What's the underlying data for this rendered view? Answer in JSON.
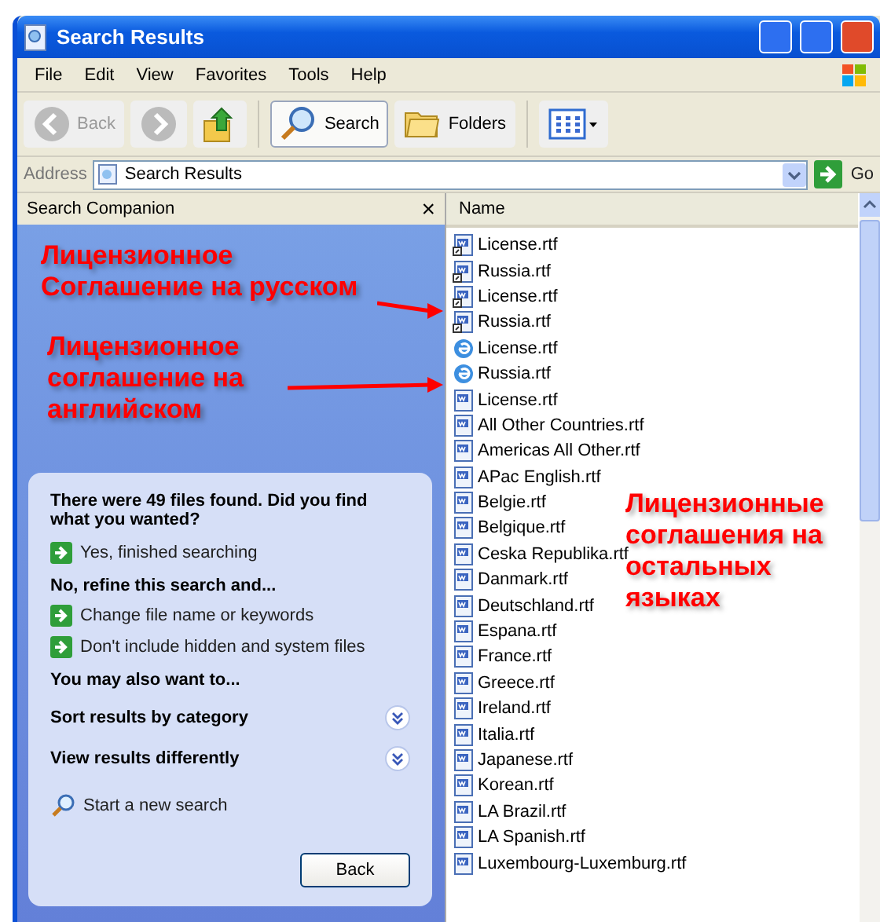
{
  "window": {
    "title": "Search Results"
  },
  "menu": [
    "File",
    "Edit",
    "View",
    "Favorites",
    "Tools",
    "Help"
  ],
  "toolbar": [
    {
      "kind": "back",
      "label": "Back",
      "disabled": true
    },
    {
      "kind": "forward",
      "disabled": true
    },
    {
      "kind": "up"
    },
    {
      "kind": "search",
      "label": "Search",
      "selected": true
    },
    {
      "kind": "folders",
      "label": "Folders",
      "selected": false
    },
    {
      "kind": "views"
    }
  ],
  "address": {
    "label": "Address",
    "value": "Search Results",
    "go": "Go"
  },
  "companion": {
    "title": "Search Companion",
    "close": "×",
    "question": "There were 49 files found. Did you find what you wanted?",
    "items": [
      {
        "kind": "link",
        "text": "Yes, finished searching"
      },
      {
        "kind": "heading",
        "text": "No, refine this search and..."
      },
      {
        "kind": "link",
        "text": "Change file name or keywords"
      },
      {
        "kind": "link",
        "text": "Don't include hidden and system files"
      },
      {
        "kind": "heading",
        "text": "You may also want to..."
      },
      {
        "kind": "expander",
        "text": "Sort results by category"
      },
      {
        "kind": "expander",
        "text": "View results differently"
      },
      {
        "kind": "search",
        "text": "Start a new search"
      }
    ],
    "back": "Back"
  },
  "files": {
    "column": "Name",
    "rows": [
      {
        "kind": "word-shortcut",
        "name": "License.rtf"
      },
      {
        "kind": "word-shortcut",
        "name": "Russia.rtf"
      },
      {
        "kind": "word-shortcut",
        "name": "License.rtf"
      },
      {
        "kind": "word-shortcut",
        "name": "Russia.rtf"
      },
      {
        "kind": "web",
        "name": "License.rtf"
      },
      {
        "kind": "web",
        "name": "Russia.rtf"
      },
      {
        "kind": "word",
        "name": "License.rtf"
      },
      {
        "kind": "word",
        "name": "All Other Countries.rtf"
      },
      {
        "kind": "word",
        "name": "Americas All Other.rtf"
      },
      {
        "kind": "word",
        "name": "APac English.rtf"
      },
      {
        "kind": "word",
        "name": "Belgie.rtf"
      },
      {
        "kind": "word",
        "name": "Belgique.rtf"
      },
      {
        "kind": "word",
        "name": "Ceska Republika.rtf"
      },
      {
        "kind": "word",
        "name": "Danmark.rtf"
      },
      {
        "kind": "word",
        "name": "Deutschland.rtf"
      },
      {
        "kind": "word",
        "name": "Espana.rtf"
      },
      {
        "kind": "word",
        "name": "France.rtf"
      },
      {
        "kind": "word",
        "name": "Greece.rtf"
      },
      {
        "kind": "word",
        "name": "Ireland.rtf"
      },
      {
        "kind": "word",
        "name": "Italia.rtf"
      },
      {
        "kind": "word",
        "name": "Japanese.rtf"
      },
      {
        "kind": "word",
        "name": "Korean.rtf"
      },
      {
        "kind": "word",
        "name": "LA Brazil.rtf"
      },
      {
        "kind": "word",
        "name": "LA Spanish.rtf"
      },
      {
        "kind": "word",
        "name": "Luxembourg-Luxemburg.rtf"
      }
    ]
  },
  "annotations": [
    {
      "text": "Лицензионное\nСоглашение на русском",
      "arrow": true
    },
    {
      "text": "Лицензионное\nсоглашение на\nанглийском",
      "arrow": true
    },
    {
      "text": "Лицензионные\nсоглашения на\nостальных\nязыках"
    }
  ]
}
